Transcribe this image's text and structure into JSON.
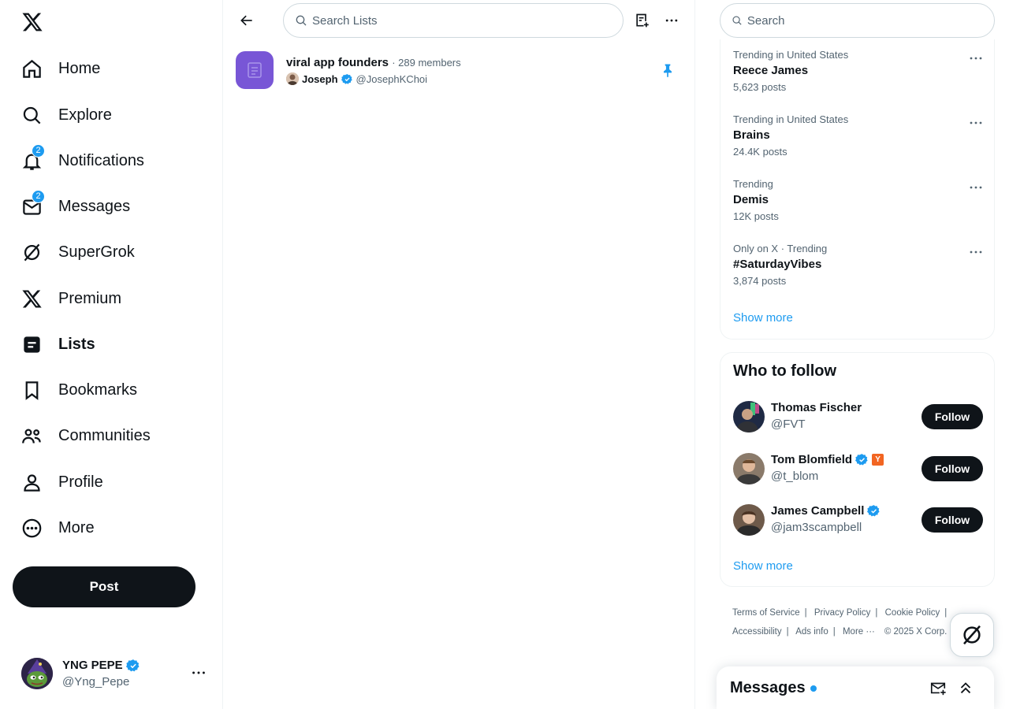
{
  "nav": {
    "items": [
      {
        "label": "Home"
      },
      {
        "label": "Explore"
      },
      {
        "label": "Notifications",
        "badge": "2"
      },
      {
        "label": "Messages",
        "badge": "2"
      },
      {
        "label": "SuperGrok"
      },
      {
        "label": "Premium"
      },
      {
        "label": "Lists",
        "active": true
      },
      {
        "label": "Bookmarks"
      },
      {
        "label": "Communities"
      },
      {
        "label": "Profile"
      },
      {
        "label": "More"
      }
    ],
    "post_label": "Post"
  },
  "account": {
    "name": "YNG PEPE",
    "handle": "@Yng_Pepe"
  },
  "main": {
    "search_placeholder": "Search Lists",
    "list": {
      "name": "viral app founders",
      "members": "· 289 members",
      "owner_name": "Joseph",
      "owner_handle": "@JosephKChoi"
    }
  },
  "sidebar": {
    "search_placeholder": "Search",
    "trends": [
      {
        "context": "Trending in United States",
        "name": "Reece James",
        "count": "5,623 posts"
      },
      {
        "context": "Trending in United States",
        "name": "Brains",
        "count": "24.4K posts"
      },
      {
        "context": "Trending",
        "name": "Demis",
        "count": "12K posts"
      },
      {
        "context": "Only on X · Trending",
        "name": "#SaturdayVibes",
        "count": "3,874 posts"
      }
    ],
    "trends_show_more": "Show more",
    "who_to_follow": {
      "title": "Who to follow",
      "follow_label": "Follow",
      "show_more": "Show more",
      "users": [
        {
          "name": "Thomas Fischer",
          "handle": "@FVT",
          "verified": false
        },
        {
          "name": "Tom Blomfield",
          "handle": "@t_blom",
          "verified": true,
          "affiliate": "Y"
        },
        {
          "name": "James Campbell",
          "handle": "@jam3scampbell",
          "verified": true
        }
      ]
    },
    "footer": {
      "row1": [
        "Terms of Service",
        "Privacy Policy",
        "Cookie Policy"
      ],
      "row2": [
        "Accessibility",
        "Ads info",
        "More ···",
        "© 2025 X Corp."
      ]
    }
  },
  "messages_drawer": {
    "title": "Messages"
  },
  "colors": {
    "accent": "#1d9bf0",
    "text": "#0f1419",
    "secondary": "#536471",
    "list_thumb": "#7856d6"
  }
}
